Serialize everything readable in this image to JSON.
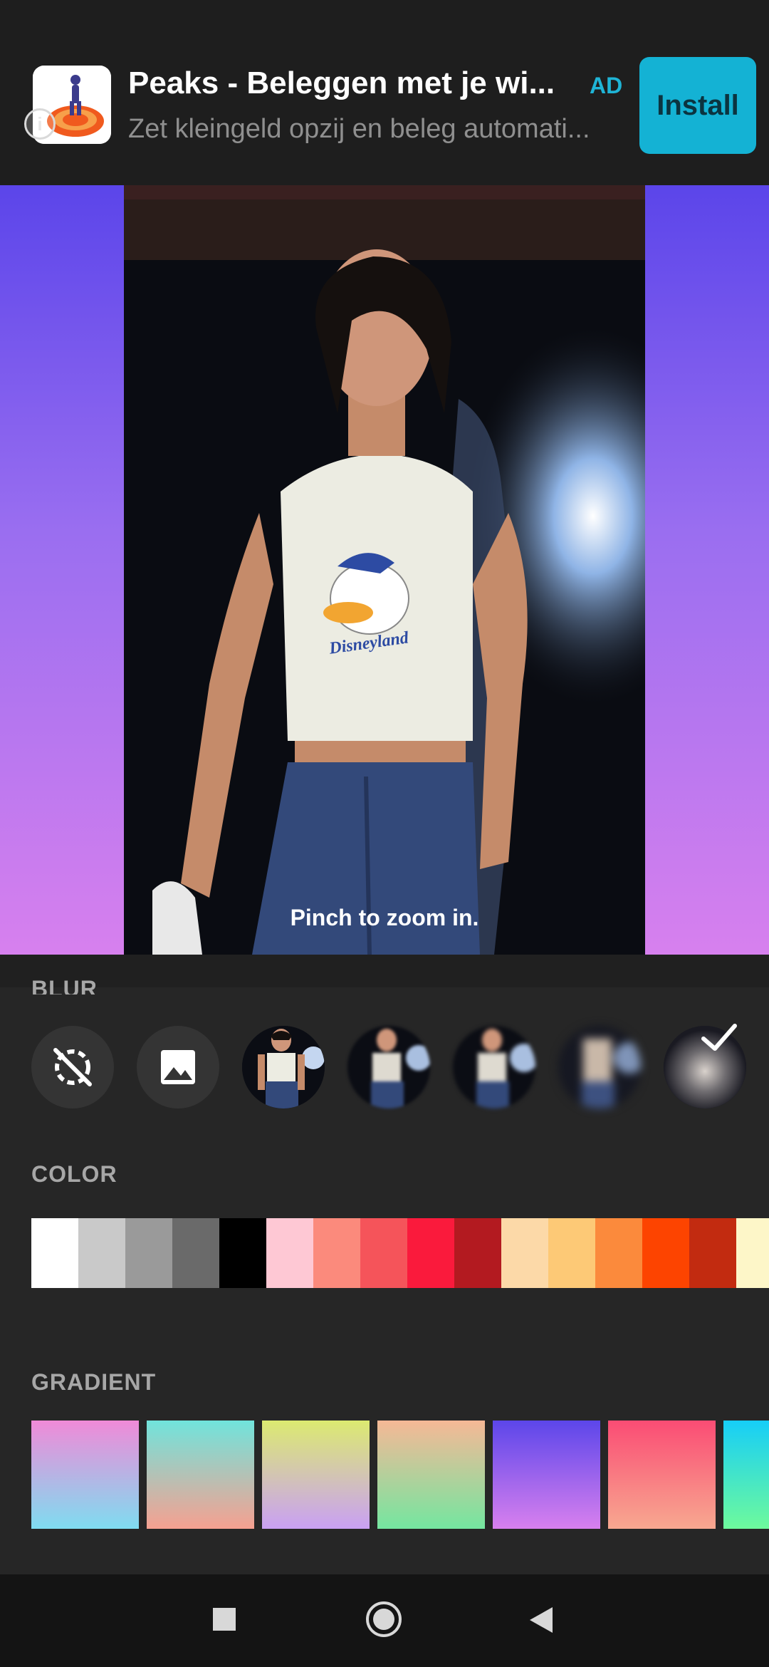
{
  "ad": {
    "title": "Peaks - Beleggen met je wi...",
    "badge": "AD",
    "subtitle": "Zet kleingeld opzij en beleg automati...",
    "install_label": "Install",
    "info_glyph": "i",
    "icon": "peaks-app-logo"
  },
  "canvas": {
    "hint": "Pinch to zoom in.",
    "background_gradient": [
      "#5b45ea",
      "#d780ee"
    ]
  },
  "photo": {
    "shirt_text": "Disneyland"
  },
  "panel": {
    "blur_title": "BLUR",
    "color_title": "COLOR",
    "gradient_title": "GRADIENT",
    "blur_options": [
      {
        "name": "no-blur",
        "icon": "blur-off-icon"
      },
      {
        "name": "image",
        "icon": "image-icon"
      },
      {
        "name": "blur-0",
        "icon": "photo-thumbnail"
      },
      {
        "name": "blur-1",
        "icon": "photo-thumbnail"
      },
      {
        "name": "blur-2",
        "icon": "photo-thumbnail"
      },
      {
        "name": "blur-3",
        "icon": "photo-thumbnail"
      },
      {
        "name": "blur-4",
        "icon": "photo-thumbnail",
        "selected": true
      }
    ],
    "colors": [
      "#ffffff",
      "#c9c9c9",
      "#9a9a9a",
      "#6a6a6a",
      "#000000",
      "#fec8d4",
      "#fb8a7c",
      "#f5545a",
      "#fa1a3c",
      "#b31a20",
      "#fcd9a8",
      "#fdc976",
      "#fb8a3c",
      "#fd4400",
      "#c22b10",
      "#fdf6c8"
    ],
    "gradients": [
      [
        "#f08ad8",
        "#7fdcf0"
      ],
      [
        "#70e4dc",
        "#f6a090"
      ],
      [
        "#dcea70",
        "#c9a0f4"
      ],
      [
        "#f6b896",
        "#74e6a0"
      ],
      [
        "#5c46ea",
        "#d880ee"
      ],
      [
        "#fa4c74",
        "#f8a890"
      ],
      [
        "#16cef8",
        "#6efa9c"
      ]
    ]
  },
  "navbar": {
    "buttons": [
      "recents-square-icon",
      "home-circle-icon",
      "back-triangle-icon"
    ]
  }
}
